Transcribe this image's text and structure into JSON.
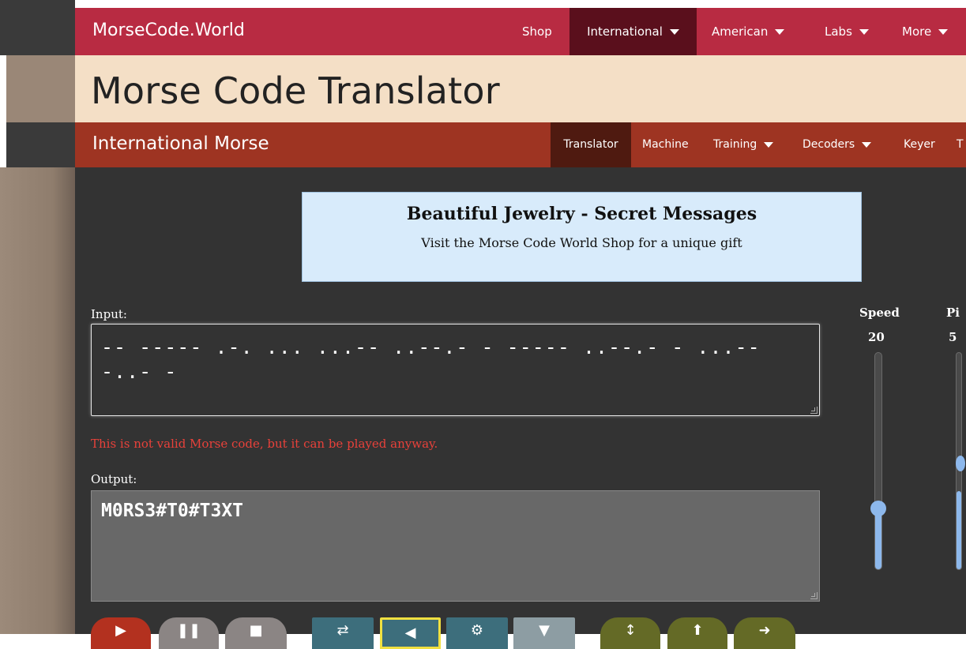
{
  "topnav": {
    "brand": "MorseCode.World",
    "items": [
      {
        "label": "Shop"
      },
      {
        "label": "International"
      },
      {
        "label": "American"
      },
      {
        "label": "Labs"
      },
      {
        "label": "More"
      }
    ]
  },
  "page": {
    "title": "Morse Code Translator"
  },
  "subnav": {
    "brand": "International Morse",
    "items": [
      {
        "label": "Translator"
      },
      {
        "label": "Machine"
      },
      {
        "label": "Training"
      },
      {
        "label": "Decoders"
      },
      {
        "label": "Keyer"
      }
    ]
  },
  "ad": {
    "title": "Beautiful Jewelry - Secret Messages",
    "subtitle": "Visit the Morse Code World Shop for a unique gift"
  },
  "input": {
    "label": "Input:",
    "value": "-- ----- .-. ... ...-- ..--.- - ----- ..--.- - ...-- -..- -"
  },
  "error": "This is not valid Morse code, but it can be played anyway.",
  "output": {
    "label": "Output:",
    "value": "M0RS3#T0#T3XT"
  },
  "speed": {
    "label": "Speed",
    "value": "20",
    "level": 0.28
  },
  "pitch": {
    "label": "Pi",
    "value": "5"
  },
  "colors": {
    "topnav": "#b82b42",
    "topnav_active": "#5a0f1c",
    "title_bar": "#f4dfc6",
    "subnav": "#9e3422",
    "subnav_active": "#4f1a10",
    "main_bg": "#333333",
    "error": "#e8413a",
    "slider": "#8db8ec"
  },
  "controls": [
    {
      "icon": "play-icon"
    },
    {
      "icon": "pause-icon"
    },
    {
      "icon": "stop-icon"
    },
    {
      "icon": "repeat-icon"
    },
    {
      "icon": "share-icon"
    },
    {
      "icon": "settings-icon"
    },
    {
      "icon": "download-icon"
    },
    {
      "icon": "swap-icon"
    },
    {
      "icon": "upload-icon"
    },
    {
      "icon": "next-icon"
    }
  ]
}
